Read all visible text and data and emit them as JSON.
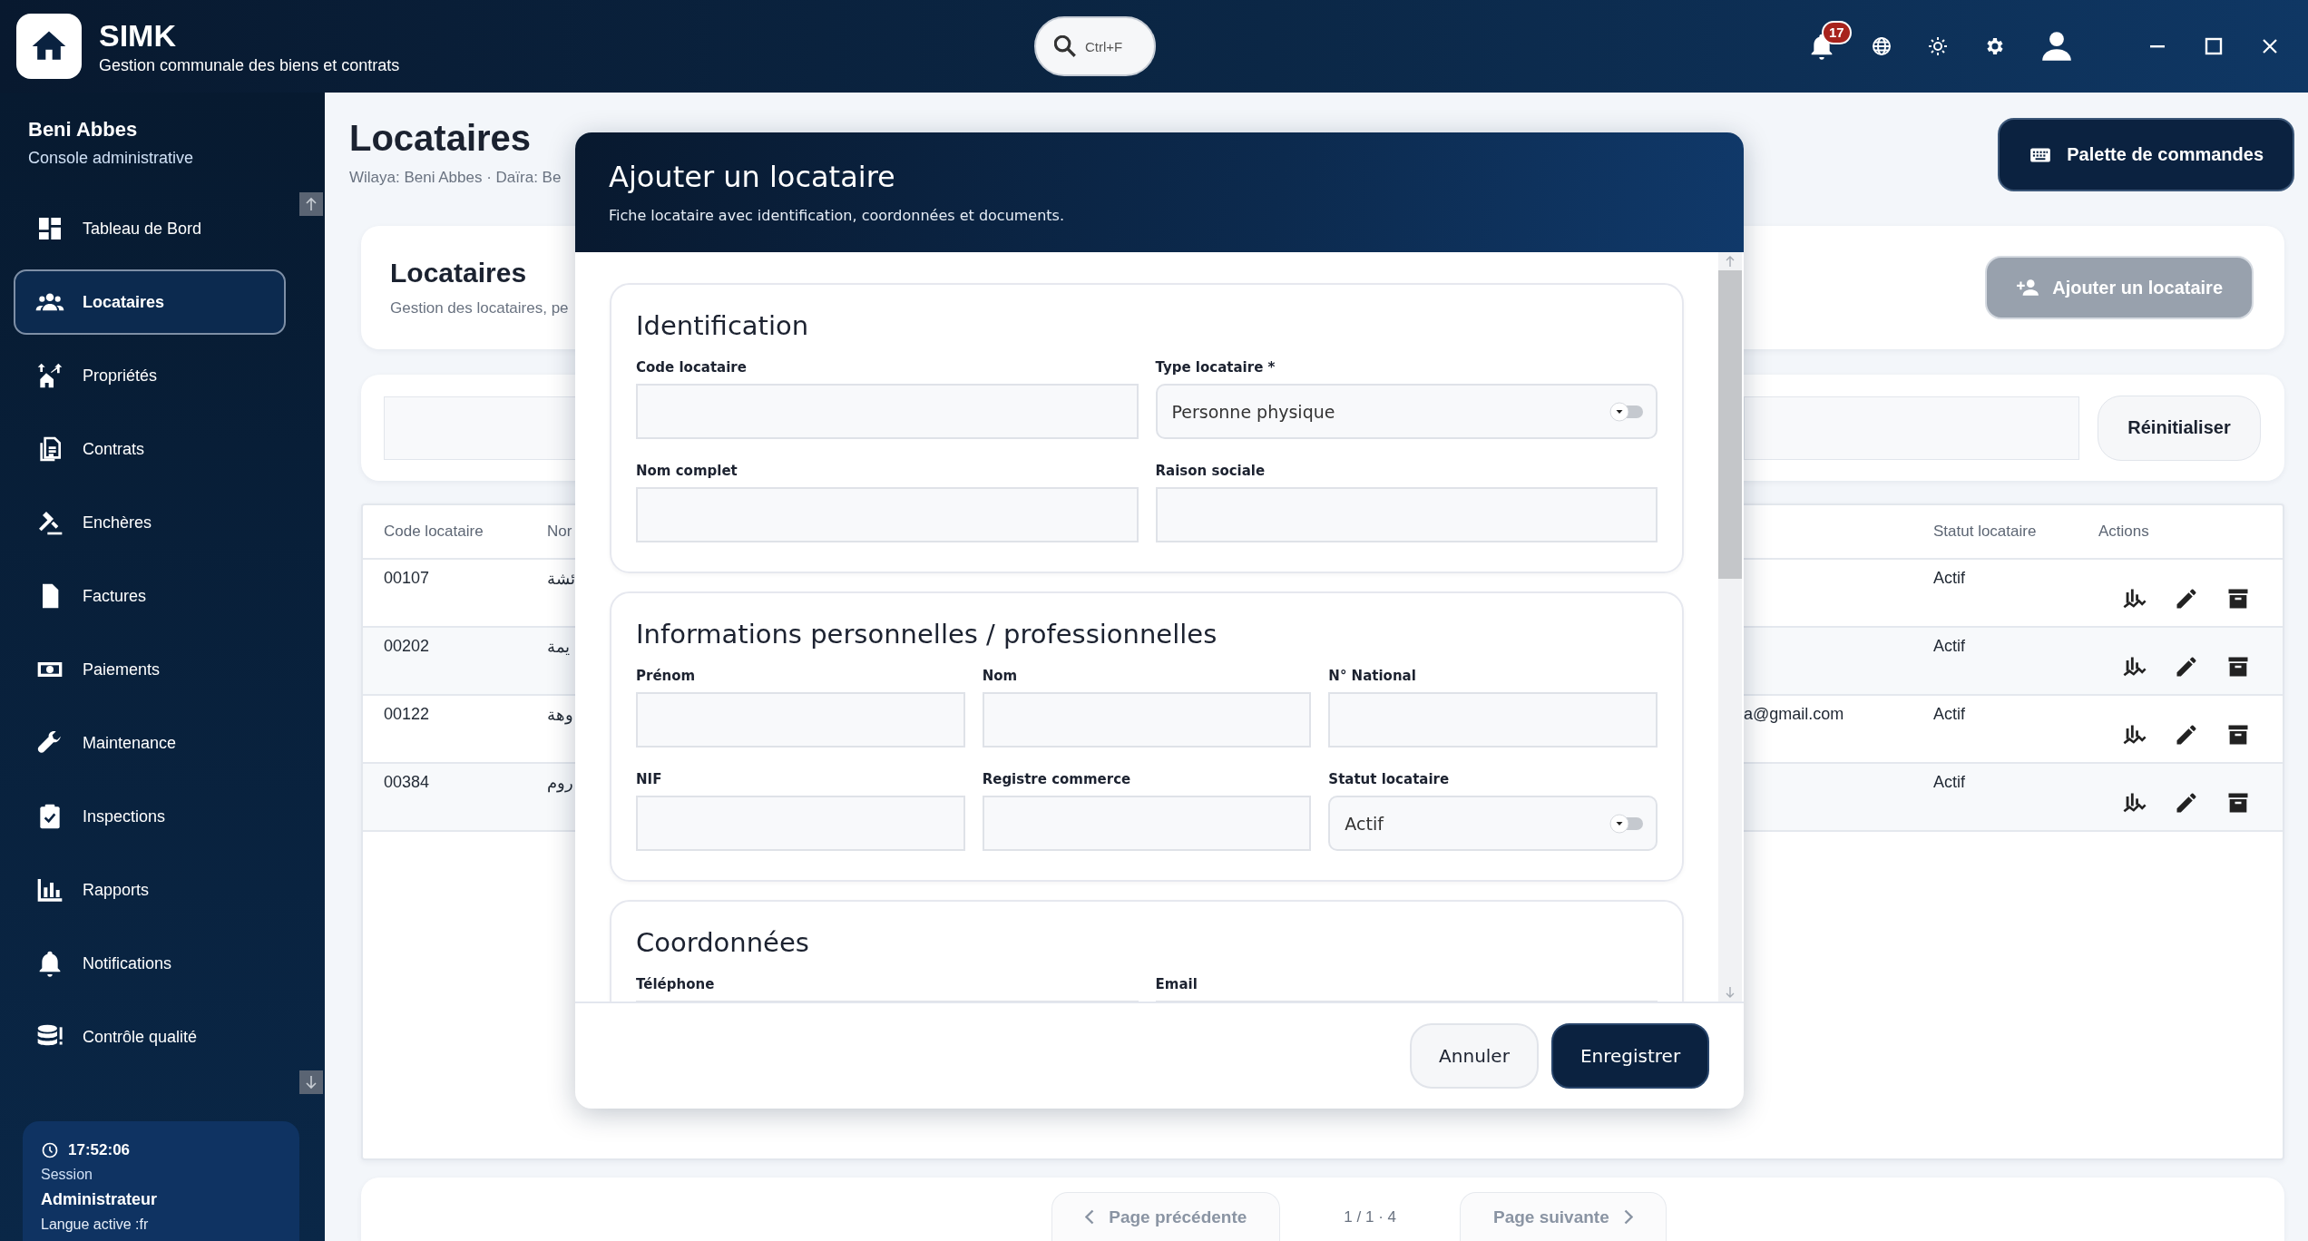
{
  "app": {
    "name": "SIMK",
    "subtitle": "Gestion communale des biens et contrats"
  },
  "search": {
    "shortcut": "Ctrl+F"
  },
  "notifications": {
    "count": "17"
  },
  "sidebar": {
    "title": "Beni Abbes",
    "subtitle": "Console administrative",
    "items": [
      {
        "label": "Tableau de Bord",
        "selected": false
      },
      {
        "label": "Locataires",
        "selected": true
      },
      {
        "label": "Propriétés",
        "selected": false
      },
      {
        "label": "Contrats",
        "selected": false
      },
      {
        "label": "Enchères",
        "selected": false
      },
      {
        "label": "Factures",
        "selected": false
      },
      {
        "label": "Paiements",
        "selected": false
      },
      {
        "label": "Maintenance",
        "selected": false
      },
      {
        "label": "Inspections",
        "selected": false
      },
      {
        "label": "Rapports",
        "selected": false
      },
      {
        "label": "Notifications",
        "selected": false
      },
      {
        "label": "Contrôle qualité",
        "selected": false
      }
    ],
    "session": {
      "time": "17:52:06",
      "label": "Session",
      "role": "Administrateur",
      "language": "Langue active :fr"
    }
  },
  "page": {
    "title": "Locataires",
    "breadcrumb": "Wilaya: Beni Abbes · Daïra: Be",
    "palette_button": "Palette de commandes"
  },
  "header_card": {
    "title": "Locataires",
    "subtitle": "Gestion des locataires, pe",
    "add_button": {
      "label": "Ajouter un locataire",
      "disabled": true
    }
  },
  "filters": {
    "reset_button": "Réinitialiser"
  },
  "table": {
    "columns": [
      "Code locataire",
      "Nor",
      "Statut locataire",
      "Actions"
    ],
    "rows": [
      {
        "code": "00107",
        "name": "ئشة",
        "status": "Actif"
      },
      {
        "code": "00202",
        "name": "يمة",
        "status": "Actif"
      },
      {
        "code": "00122",
        "name": "وهة",
        "email": "a@gmail.com",
        "status": "Actif"
      },
      {
        "code": "00384",
        "name": "روم",
        "status": "Actif"
      }
    ]
  },
  "pagination": {
    "previous": "Page précédente",
    "info": "1 / 1 · 4",
    "next": "Page suivante"
  },
  "modal": {
    "title": "Ajouter un locataire",
    "subtitle": "Fiche locataire avec identification, coordonnées et documents.",
    "sections": [
      {
        "title": "Identification",
        "fields": [
          {
            "label": "Code locataire",
            "kind": "text"
          },
          {
            "label": "Type locataire *",
            "kind": "select",
            "value": "Personne physique"
          },
          {
            "label": "Nom complet",
            "kind": "text"
          },
          {
            "label": "Raison sociale",
            "kind": "text"
          }
        ]
      },
      {
        "title": "Informations personnelles / professionnelles",
        "fields": [
          {
            "label": "Prénom",
            "kind": "text"
          },
          {
            "label": "Nom",
            "kind": "text"
          },
          {
            "label": "N° National",
            "kind": "text"
          },
          {
            "label": "NIF",
            "kind": "text"
          },
          {
            "label": "Registre commerce",
            "kind": "text"
          },
          {
            "label": "Statut locataire",
            "kind": "select",
            "value": "Actif"
          }
        ]
      },
      {
        "title": "Coordonnées",
        "fields": [
          {
            "label": "Téléphone",
            "kind": "text"
          },
          {
            "label": "Email",
            "kind": "text"
          }
        ]
      }
    ],
    "cancel_button": "Annuler",
    "save_button": "Enregistrer"
  }
}
